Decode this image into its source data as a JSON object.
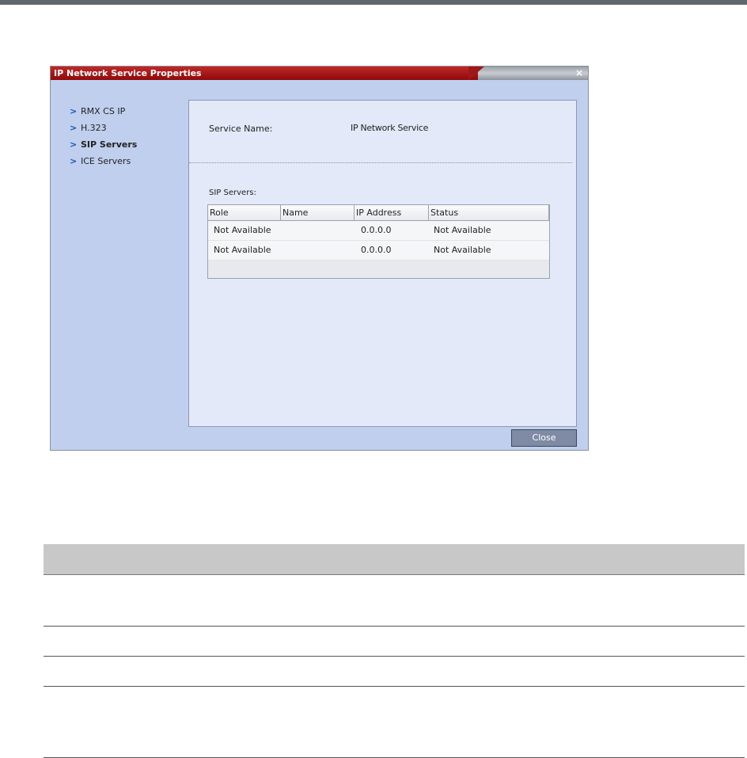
{
  "dialog": {
    "title": "IP Network Service Properties",
    "close_icon": "×",
    "nav": [
      {
        "label": "RMX CS IP",
        "active": false
      },
      {
        "label": "H.323",
        "active": false
      },
      {
        "label": "SIP Servers",
        "active": true
      },
      {
        "label": "ICE Servers",
        "active": false
      }
    ],
    "service_name_label": "Service Name:",
    "service_name_value": "IP Network Service",
    "sip_servers_label": "SIP Servers:",
    "table": {
      "columns": [
        "Role",
        "Name",
        "IP Address",
        "Status"
      ],
      "rows": [
        {
          "role": "Not Available",
          "name": "",
          "ip": "0.0.0.0",
          "status": "Not Available"
        },
        {
          "role": "Not Available",
          "name": "",
          "ip": "0.0.0.0",
          "status": "Not Available"
        }
      ]
    },
    "close_button": "Close"
  },
  "icons": {
    "nav_chevron": "chevron-right-icon",
    "title_close": "close-icon"
  },
  "colors": {
    "title_red": "#b01c1c",
    "dialog_bg": "#c0cfee",
    "panel_bg": "#e3e9f8",
    "chevron": "#1a53b8",
    "close_button": "#7f8ba5"
  }
}
